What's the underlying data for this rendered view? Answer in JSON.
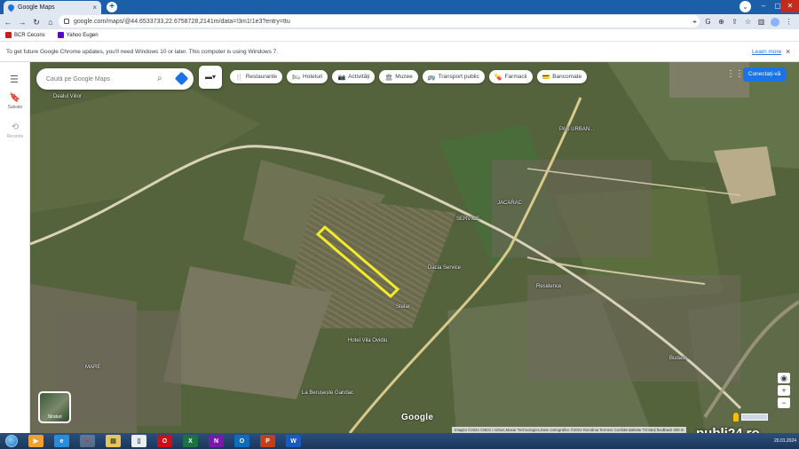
{
  "browser": {
    "tab_title": "Google Maps",
    "tab_close": "×",
    "new_tab": "+",
    "tab_menu": "⌄",
    "url": "google.com/maps/@44.6533733,22.6758728,2141m/data=!3m1!1e3?entry=ttu",
    "window_controls": [
      "–",
      "▢",
      "✕"
    ]
  },
  "bookmarks": [
    {
      "label": "BCR Cecons",
      "color": "#c5221f"
    },
    {
      "label": "Yahoo Eugen",
      "color": "#6001d2"
    }
  ],
  "infobar": {
    "message": "To get future Google Chrome updates, you'll need Windows 10 or later. This computer is using Windows 7.",
    "link": "Learn more",
    "close": "×"
  },
  "rail": {
    "saved": "Salvate",
    "recent": "Recente"
  },
  "search": {
    "placeholder": "Caută pe Google Maps"
  },
  "chips": [
    {
      "icon": "🍴",
      "label": "Restaurante"
    },
    {
      "icon": "🛏",
      "label": "Hoteluri"
    },
    {
      "icon": "📷",
      "label": "Activități"
    },
    {
      "icon": "🏛",
      "label": "Muzee"
    },
    {
      "icon": "🚌",
      "label": "Transport public"
    },
    {
      "icon": "💊",
      "label": "Farmacii"
    },
    {
      "icon": "💳",
      "label": "Bancomate"
    }
  ],
  "signin": "Conectați-vă",
  "layers_label": "Straturi",
  "map_labels": {
    "dealul": "Dealul Viilor",
    "pasul": "PAS URBAN...",
    "jacarac": "JACARAC",
    "service": "SERVICE",
    "dacia": "Dacia Service",
    "residence": "Residence",
    "hotel": "Hotel Vila Ovidiu",
    "stelar": "Stelar",
    "budasu": "Budasu",
    "beruste": "La Berușește Gandac",
    "maretosen": "MARE"
  },
  "google_logo": "Google",
  "attribution": "Imagini ©2024 CNES / Airbus,Maxar Technologies,Date cartografice ©2024   România   Termeni   Confidențialitate   Trimiteți feedback   200 m",
  "watermark": "publi24.ro",
  "clock": "20.01.2024",
  "taskbar_apps": [
    {
      "name": "media",
      "color": "#f0a030",
      "glyph": "▶"
    },
    {
      "name": "ie",
      "color": "#2a8bd8",
      "glyph": "e"
    },
    {
      "name": "chrome",
      "color": "#d93025",
      "glyph": "●"
    },
    {
      "name": "explorer",
      "color": "#e8c45a",
      "glyph": "▤"
    },
    {
      "name": "notepad",
      "color": "#e8eef5",
      "glyph": "▯"
    },
    {
      "name": "opera",
      "color": "#cc0f16",
      "glyph": "O"
    },
    {
      "name": "excel",
      "color": "#1d7044",
      "glyph": "X"
    },
    {
      "name": "onenote",
      "color": "#7719aa",
      "glyph": "N"
    },
    {
      "name": "outlook",
      "color": "#0f6cbd",
      "glyph": "O"
    },
    {
      "name": "powerpoint",
      "color": "#c43e1c",
      "glyph": "P"
    },
    {
      "name": "word",
      "color": "#185abd",
      "glyph": "W"
    }
  ]
}
